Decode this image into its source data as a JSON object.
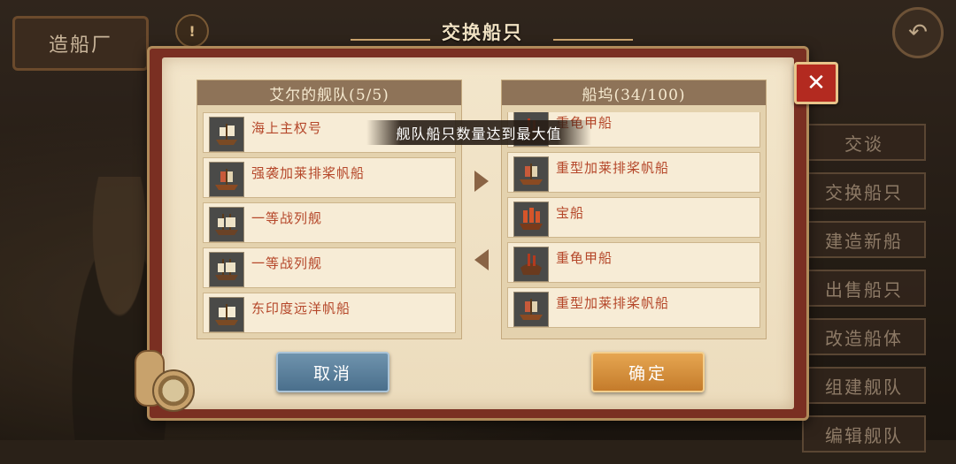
{
  "header": {
    "shipyard_label": "造船厂",
    "dialog_title": "交换船只"
  },
  "left_panel": {
    "title": "艾尔的舰队(5/5)",
    "ships": [
      {
        "name": "海上主权号",
        "icon": "galleon-ship-icon"
      },
      {
        "name": "强袭加莱排桨帆船",
        "icon": "galley-ship-icon"
      },
      {
        "name": "一等战列舰",
        "icon": "warship-icon"
      },
      {
        "name": "一等战列舰",
        "icon": "warship-icon"
      },
      {
        "name": "东印度远洋帆船",
        "icon": "east-indiaman-icon"
      }
    ]
  },
  "right_panel": {
    "title": "船坞(34/100)",
    "ships": [
      {
        "name": "重龟甲船",
        "icon": "turtle-ship-icon"
      },
      {
        "name": "重型加莱排桨帆船",
        "icon": "galley-ship-icon"
      },
      {
        "name": "宝船",
        "icon": "treasure-ship-icon"
      },
      {
        "name": "重龟甲船",
        "icon": "turtle-ship-icon"
      },
      {
        "name": "重型加莱排桨帆船",
        "icon": "galley-ship-icon"
      }
    ]
  },
  "toast": "舰队船只数量达到最大值",
  "buttons": {
    "cancel": "取消",
    "confirm": "确定",
    "close": "✕"
  },
  "side_menu": [
    "交谈",
    "交换船只",
    "建造新船",
    "出售船只",
    "改造船体",
    "组建舰队",
    "编辑舰队"
  ],
  "colors": {
    "accent_red": "#b32a20",
    "label_red": "#b5472a",
    "confirm_orange": "#c47b2b",
    "cancel_blue": "#4a6f8c"
  }
}
